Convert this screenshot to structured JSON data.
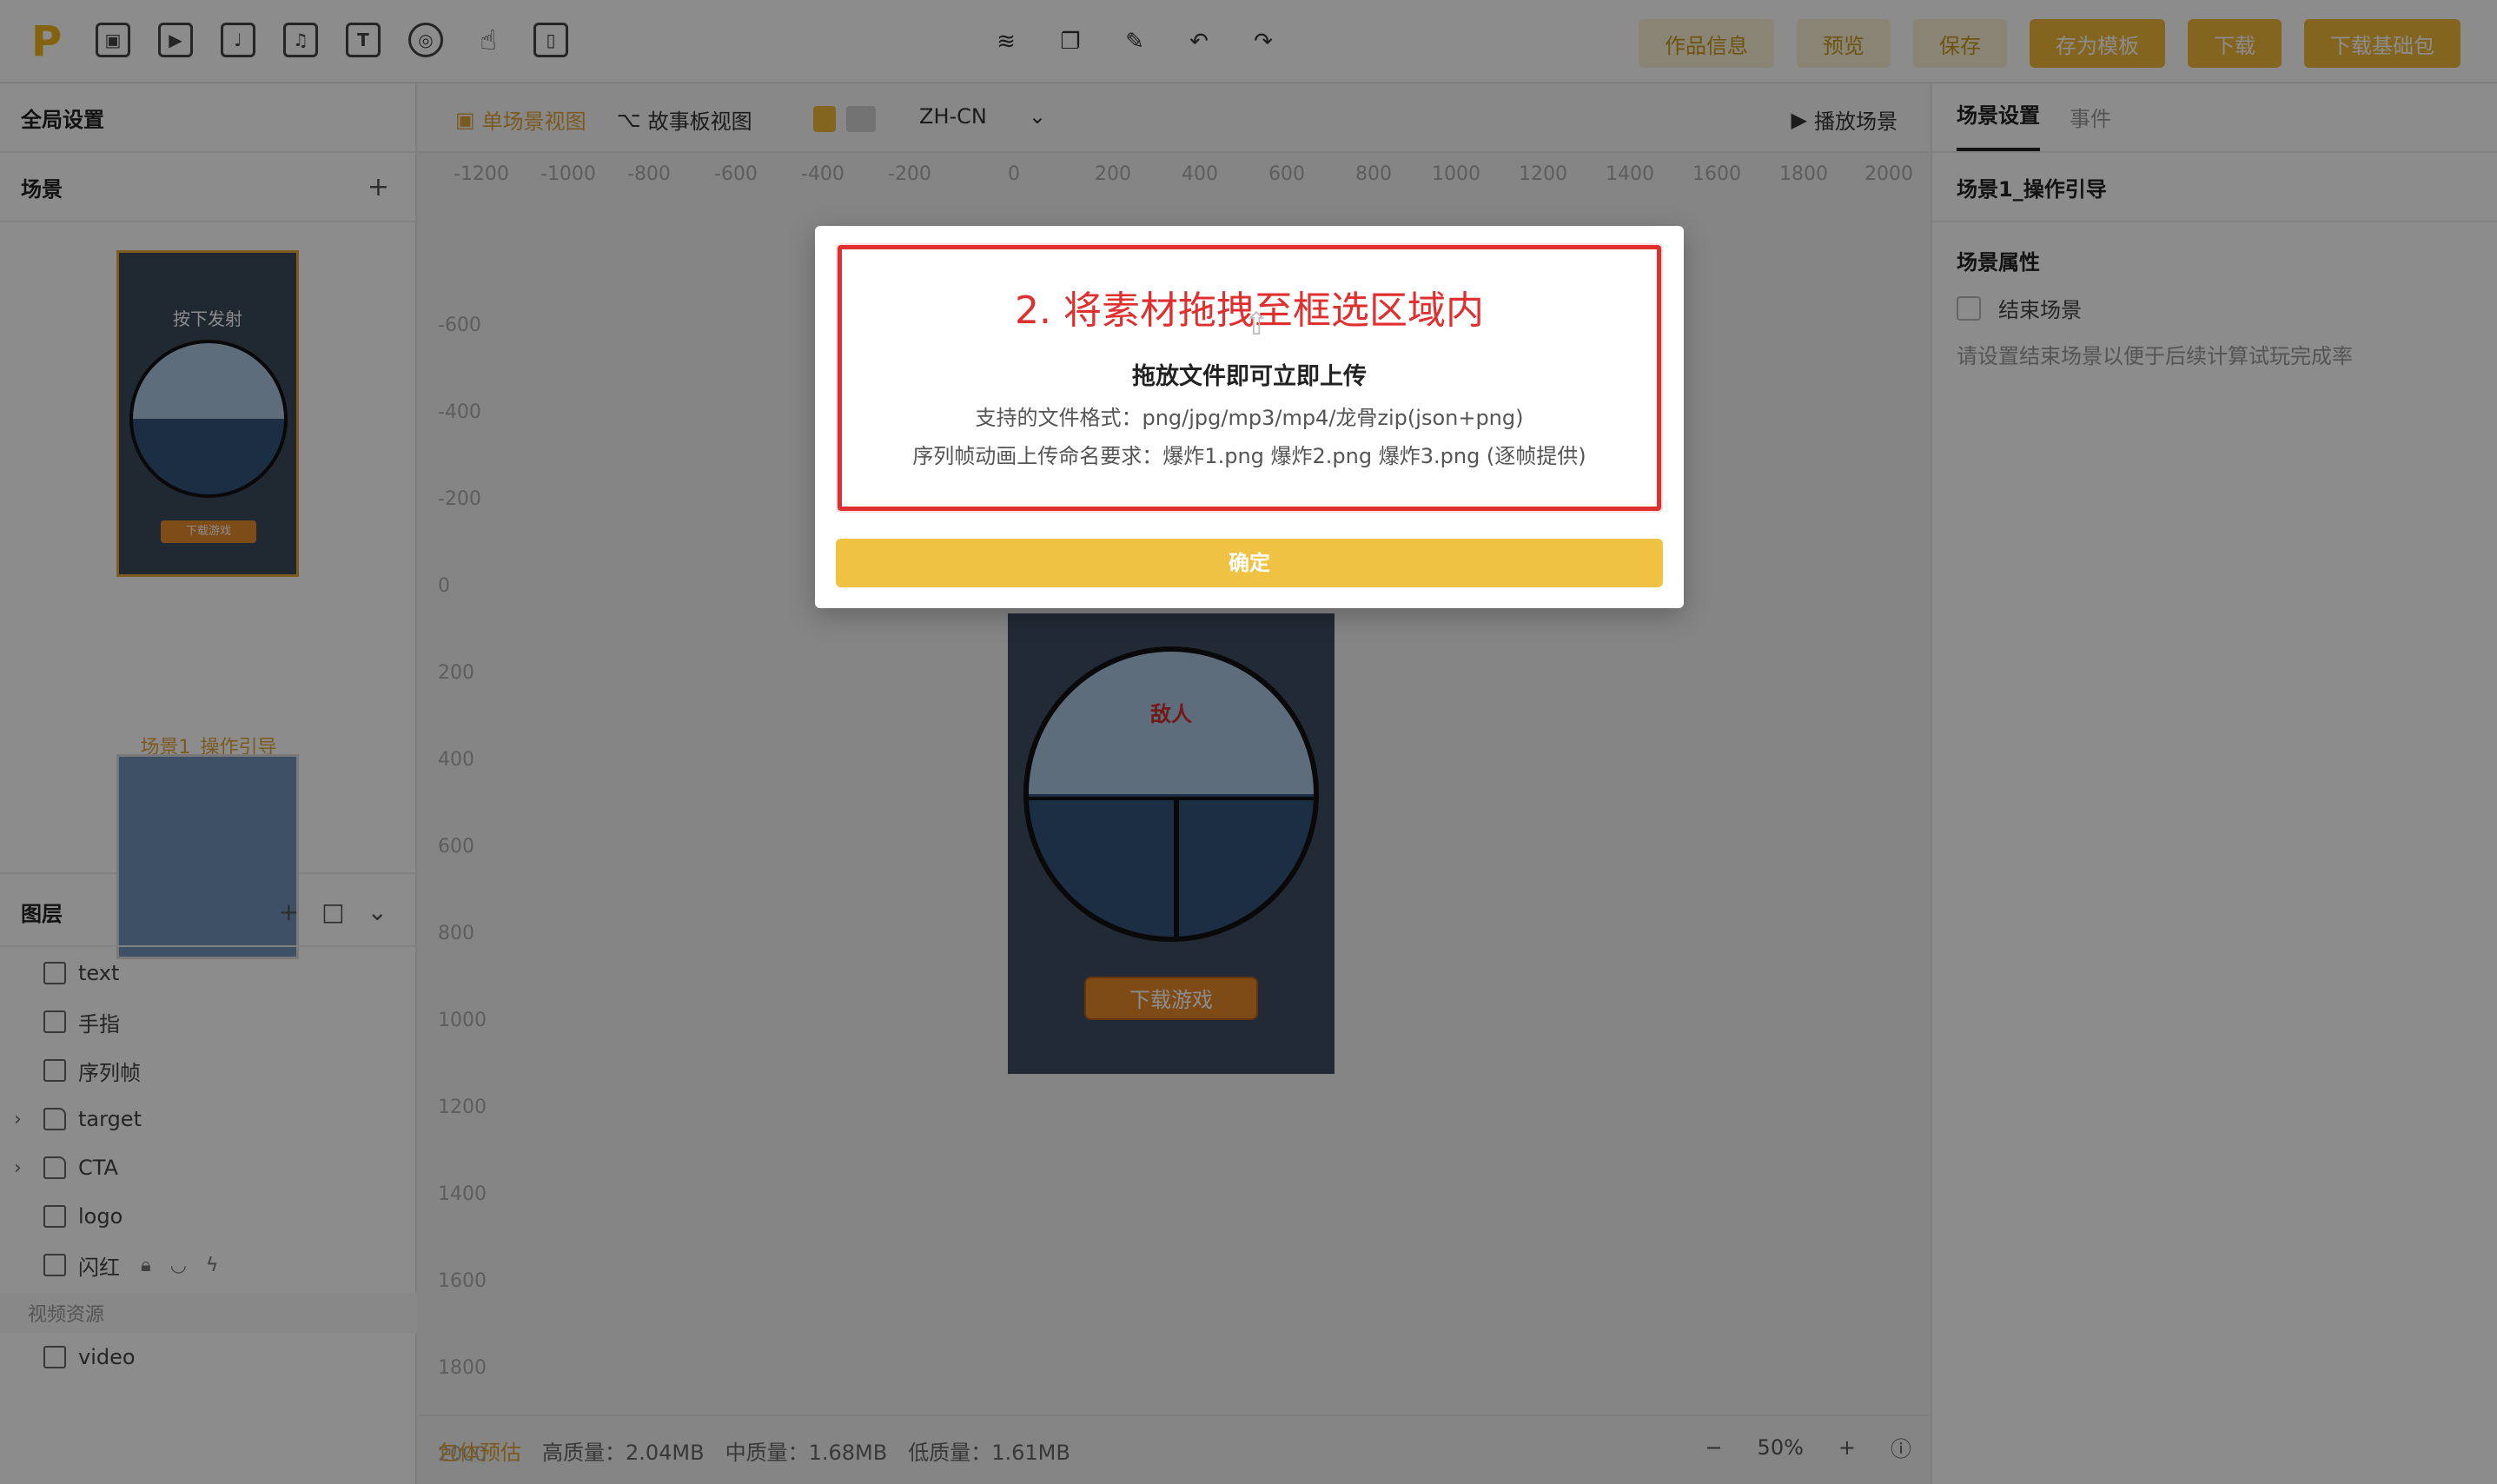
{
  "toolbar": {
    "logo": "P",
    "tools": [
      {
        "icon": "image-icon",
        "glyph": "▣"
      },
      {
        "icon": "video-icon",
        "glyph": "▶"
      },
      {
        "icon": "audio-icon",
        "glyph": "♩"
      },
      {
        "icon": "music-icon",
        "glyph": "♫"
      },
      {
        "icon": "text-icon",
        "glyph": "T"
      },
      {
        "icon": "target-icon",
        "glyph": "◎"
      },
      {
        "icon": "hand-pointer-icon",
        "glyph": "☝"
      },
      {
        "icon": "device-icon",
        "glyph": "▯"
      }
    ],
    "center": [
      {
        "icon": "layers-icon",
        "glyph": "≋"
      },
      {
        "icon": "copy-icon",
        "glyph": "❐"
      },
      {
        "icon": "brush-icon",
        "glyph": "✎"
      },
      {
        "icon": "undo-icon",
        "glyph": "↶"
      },
      {
        "icon": "redo-icon",
        "glyph": "↷"
      }
    ],
    "actions": {
      "work_info": "作品信息",
      "preview": "预览",
      "save": "保存",
      "save_template": "存为模板",
      "download": "下载",
      "download_base": "下载基础包"
    }
  },
  "left": {
    "global_settings": "全局设置",
    "scenes_title": "场景",
    "scenes_add": "+",
    "scene_thumb_text": "按下发射",
    "scene_thumb_cta": "下载游戏",
    "scene_label": "场景1_操作引导",
    "layers_title": "图层",
    "layers_tools": [
      "+",
      "□",
      "⌄"
    ],
    "layers": [
      {
        "name": "text",
        "icon": "text-layer-icon",
        "folder": false
      },
      {
        "name": "手指",
        "icon": "image-layer-icon",
        "folder": false
      },
      {
        "name": "序列帧",
        "icon": "sequence-layer-icon",
        "folder": false
      },
      {
        "name": "target",
        "icon": "folder-icon",
        "folder": true
      },
      {
        "name": "CTA",
        "icon": "folder-icon",
        "folder": true
      },
      {
        "name": "logo",
        "icon": "image-layer-icon",
        "folder": false
      },
      {
        "name": "闪红",
        "icon": "image-layer-icon",
        "folder": false
      }
    ],
    "video_section": "视频资源",
    "video_item": "video"
  },
  "canvas": {
    "single_view": "单场景视图",
    "story_view": "故事板视图",
    "lang": "ZH-CN",
    "play_scene": "播放场景",
    "ruler_h": [
      "-1200",
      "-1000",
      "-800",
      "-600",
      "-400",
      "-200",
      "0",
      "200",
      "400",
      "600",
      "800",
      "1000",
      "1200",
      "1400",
      "1600",
      "1800",
      "2000"
    ],
    "ruler_v": [
      "-600",
      "-400",
      "-200",
      "0",
      "200",
      "400",
      "600",
      "800",
      "1000",
      "1200",
      "1400",
      "1600",
      "1800",
      "2000"
    ],
    "phone_enemy": "敌人",
    "phone_cta": "下载游戏",
    "status": {
      "estimate": "包体预估",
      "high": "高质量：2.04MB",
      "mid": "中质量：1.68MB",
      "low": "低质量：1.61MB",
      "zoom": "50%"
    }
  },
  "right": {
    "tab_scene": "场景设置",
    "tab_event": "事件",
    "scene_name": "场景1_操作引导",
    "props_title": "场景属性",
    "end_scene": "结束场景",
    "hint": "请设置结束场景以便于后续计算试玩完成率"
  },
  "modal": {
    "annotation": "2. 将素材拖拽至框选区域内",
    "title": "拖放文件即可立即上传",
    "formats": "支持的文件格式：png/jpg/mp3/mp4/龙骨zip(json+png)",
    "naming": "序列帧动画上传命名要求：爆炸1.png 爆炸2.png 爆炸3.png (逐帧提供)",
    "confirm": "确定"
  },
  "colors": {
    "accent": "#f0b93b",
    "annotation_red": "#e02f2f"
  }
}
